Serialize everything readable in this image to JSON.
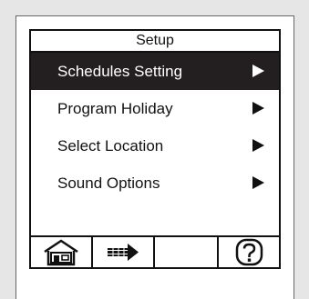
{
  "screen": {
    "title": "Setup"
  },
  "menu": {
    "items": [
      {
        "label": "Schedules Setting",
        "selected": true,
        "icon": "play-arrow-icon"
      },
      {
        "label": "Program Holiday",
        "selected": false,
        "icon": "play-arrow-icon"
      },
      {
        "label": "Select Location",
        "selected": false,
        "icon": "play-arrow-icon"
      },
      {
        "label": "Sound Options",
        "selected": false,
        "icon": "play-arrow-icon"
      }
    ]
  },
  "toolbar": {
    "buttons": [
      {
        "icon": "home-icon"
      },
      {
        "icon": "arrow-right-icon"
      },
      {
        "icon": ""
      },
      {
        "icon": "help-icon"
      }
    ]
  },
  "colors": {
    "selected_background": "#231f20",
    "foreground": "#111111",
    "background": "#ffffff"
  }
}
